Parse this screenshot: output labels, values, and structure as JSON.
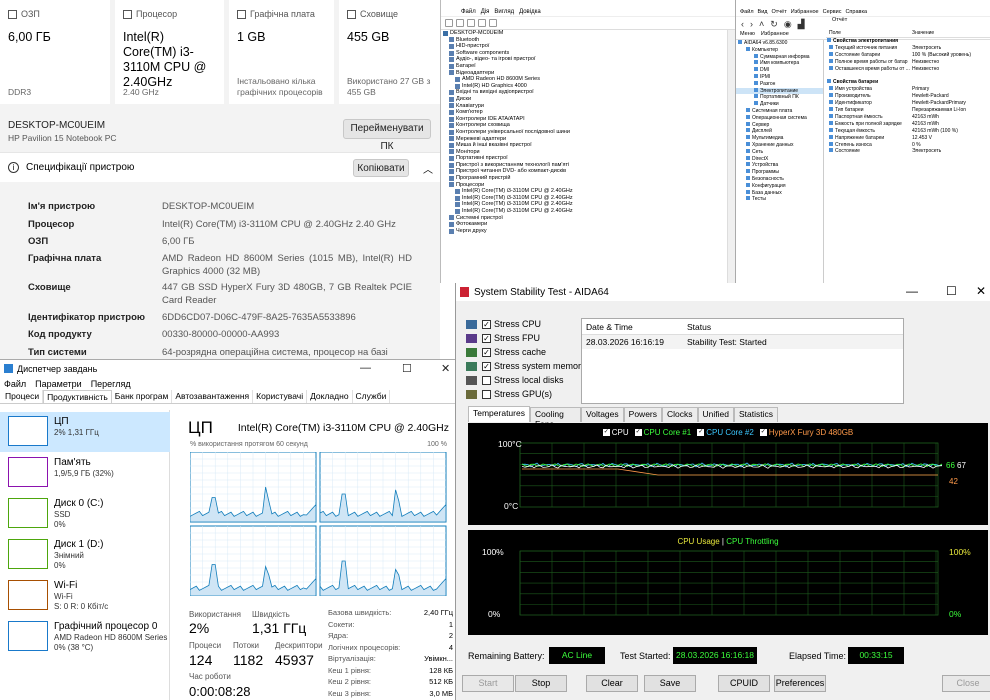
{
  "settings": {
    "cards": [
      {
        "icon": "memory-icon",
        "label": "ОЗП",
        "value": "6,00 ГБ",
        "sub": "DDR3"
      },
      {
        "icon": "processor-icon",
        "label": "Процесор",
        "value": "Intel(R) Core(TM) i3-3110M CPU @ 2.40GHz",
        "sub": "2.40 GHz"
      },
      {
        "icon": "gpu-icon",
        "label": "Графічна плата",
        "value": "1 GB",
        "sub": "Інстальовано кілька графічних процесорів"
      },
      {
        "icon": "storage-icon",
        "label": "Сховище",
        "value": "455 GB",
        "sub": "Використано 27 GB з 455 GB"
      }
    ],
    "device_name": "DESKTOP-MC0UEIM",
    "device_model": "HP Pavilion 15 Notebook PC",
    "rename_button": "Перейменувати ПК",
    "spec_header": "Специфікації пристрою",
    "copy_button": "Копіювати",
    "specs": [
      {
        "k": "Ім'я пристрою",
        "v": "DESKTOP-MC0UEIM"
      },
      {
        "k": "Процесор",
        "v": "Intel(R) Core(TM) i3-3110M CPU @ 2.40GHz   2.40 GHz"
      },
      {
        "k": "ОЗП",
        "v": "6,00 ГБ"
      },
      {
        "k": "Графічна плата",
        "v": "AMD Radeon HD 8600M Series (1015 MB), Intel(R) HD Graphics 4000 (32 MB)"
      },
      {
        "k": "Сховище",
        "v": "447 GB SSD HyperX Fury 3D 480GB, 7 GB Realtek PCIE Card Reader"
      },
      {
        "k": "Ідентифікатор пристрою",
        "v": "6DD6CD07-D06C-479F-8A25-7635A5533896"
      },
      {
        "k": "Код продукту",
        "v": "00330-80000-00000-AA993"
      },
      {
        "k": "Тип системи",
        "v": "64-розрядна операційна система, процесор на базі"
      }
    ]
  },
  "devmgr": {
    "menu": [
      "Файл",
      "Дія",
      "Вигляд",
      "Довідка"
    ],
    "tree": [
      {
        "t": "DESKTOP-MC0UEIM",
        "d": 0
      },
      {
        "t": "Bluetooth",
        "d": 1
      },
      {
        "t": "HID-пристрої",
        "d": 1
      },
      {
        "t": "Software components",
        "d": 1
      },
      {
        "t": "Аудіо-, відео- та ігрові пристрої",
        "d": 1
      },
      {
        "t": "Батареї",
        "d": 1
      },
      {
        "t": "Відеоадаптери",
        "d": 1
      },
      {
        "t": "AMD Radeon HD 8600M Series",
        "d": 2
      },
      {
        "t": "Intel(R) HD Graphics 4000",
        "d": 2
      },
      {
        "t": "Вхідні та вихідні аудіопристрої",
        "d": 1
      },
      {
        "t": "Диски",
        "d": 1
      },
      {
        "t": "Клавіатури",
        "d": 1
      },
      {
        "t": "Комп'ютер",
        "d": 1
      },
      {
        "t": "Контролери IDE ATA/ATAPI",
        "d": 1
      },
      {
        "t": "Контролери сховища",
        "d": 1
      },
      {
        "t": "Контролери універсальної послідовної шини",
        "d": 1
      },
      {
        "t": "Мережеві адаптери",
        "d": 1
      },
      {
        "t": "Миша й інші вказівні пристрої",
        "d": 1
      },
      {
        "t": "Монітори",
        "d": 1
      },
      {
        "t": "Портативні пристрої",
        "d": 1
      },
      {
        "t": "Пристрої з використанням технології пам'яті",
        "d": 1
      },
      {
        "t": "Пристрої читання DVD- або компакт-дисків",
        "d": 1
      },
      {
        "t": "Програмний пристрій",
        "d": 1
      },
      {
        "t": "Процесори",
        "d": 1
      },
      {
        "t": "Intel(R) Core(TM) i3-3110M CPU @ 2.40GHz",
        "d": 2
      },
      {
        "t": "Intel(R) Core(TM) i3-3110M CPU @ 2.40GHz",
        "d": 2
      },
      {
        "t": "Intel(R) Core(TM) i3-3110M CPU @ 2.40GHz",
        "d": 2
      },
      {
        "t": "Intel(R) Core(TM) i3-3110M CPU @ 2.40GHz",
        "d": 2
      },
      {
        "t": "Системні пристрої",
        "d": 1
      },
      {
        "t": "Фотокамери",
        "d": 1
      },
      {
        "t": "Черги друку",
        "d": 1
      }
    ]
  },
  "aida": {
    "menu": [
      "Файл",
      "Вид",
      "Отчёт",
      "Избранное",
      "Сервис",
      "Справка"
    ],
    "nav_report": "Отчёт",
    "tabs": [
      "Меню",
      "Избранное"
    ],
    "col_field": "Поле",
    "col_value": "Значение",
    "tree": [
      {
        "t": "AIDA64 v6.85.6300",
        "d": 0
      },
      {
        "t": "Компьютер",
        "d": 1
      },
      {
        "t": "Суммарная информа",
        "d": 2
      },
      {
        "t": "Имя компьютера",
        "d": 2
      },
      {
        "t": "DMI",
        "d": 2
      },
      {
        "t": "IPMI",
        "d": 2
      },
      {
        "t": "Разгон",
        "d": 2
      },
      {
        "t": "Электропитание",
        "d": 2,
        "sel": true
      },
      {
        "t": "Портативный ПК",
        "d": 2
      },
      {
        "t": "Датчики",
        "d": 2
      },
      {
        "t": "Системная плата",
        "d": 1
      },
      {
        "t": "Операционная система",
        "d": 1
      },
      {
        "t": "Сервер",
        "d": 1
      },
      {
        "t": "Дисплей",
        "d": 1
      },
      {
        "t": "Мультимедиа",
        "d": 1
      },
      {
        "t": "Хранение данных",
        "d": 1
      },
      {
        "t": "Сеть",
        "d": 1
      },
      {
        "t": "DirectX",
        "d": 1
      },
      {
        "t": "Устройства",
        "d": 1
      },
      {
        "t": "Программы",
        "d": 1
      },
      {
        "t": "Безопасность",
        "d": 1
      },
      {
        "t": "Конфигурация",
        "d": 1
      },
      {
        "t": "База данных",
        "d": 1
      },
      {
        "t": "Тесты",
        "d": 1
      }
    ],
    "rows": [
      {
        "f": "Свойства электропитания",
        "v": "",
        "h": true
      },
      {
        "f": "Текущий источник питания",
        "v": "Электросеть"
      },
      {
        "f": "Состояние батареи",
        "v": "100 % (Высокий уровень)"
      },
      {
        "f": "Полное время работы от батар",
        "v": "Неизвестно"
      },
      {
        "f": "Оставшееся время работы от ...",
        "v": "Неизвестно"
      },
      {
        "f": "",
        "v": ""
      },
      {
        "f": "Свойства батареи",
        "v": "",
        "h": true
      },
      {
        "f": "Имя устройства",
        "v": "Primary"
      },
      {
        "f": "Производитель",
        "v": "Hewlett-Packard"
      },
      {
        "f": "Идентификатор",
        "v": "Hewlett-PackardPrimary"
      },
      {
        "f": "Тип батареи",
        "v": "Перезаряжаемая Li-Ion"
      },
      {
        "f": "Паспортная ёмкость",
        "v": "42163 mWh"
      },
      {
        "f": "Ёмкость при полной зарядке",
        "v": "42163 mWh"
      },
      {
        "f": "Текущая ёмкость",
        "v": "42163 mWh  (100 %)"
      },
      {
        "f": "Напряжение батареи",
        "v": "12.453 V"
      },
      {
        "f": "Степень износа",
        "v": "0 %"
      },
      {
        "f": "Состояние",
        "v": "Электросеть"
      }
    ]
  },
  "taskmgr": {
    "title": "Диспетчер завдань",
    "menu": [
      "Файл",
      "Параметри",
      "Перегляд"
    ],
    "tabs": [
      "Процеси",
      "Продуктивність",
      "Банк програм",
      "Автозавантаження",
      "Користувачі",
      "Докладно",
      "Служби"
    ],
    "side": [
      {
        "name": "ЦП",
        "s1": "2% 1,31 ГГц",
        "s2": "",
        "color": "#1979ca"
      },
      {
        "name": "Пам'ять",
        "s1": "1,9/5,9 ГБ (32%)",
        "s2": "",
        "color": "#8b12ae"
      },
      {
        "name": "Диск 0 (C:)",
        "s1": "SSD",
        "s2": "0%",
        "color": "#4da60c"
      },
      {
        "name": "Диск 1 (D:)",
        "s1": "Знімний",
        "s2": "0%",
        "color": "#4da60c"
      },
      {
        "name": "Wi-Fi",
        "s1": "Wi-Fi",
        "s2": "S: 0 R: 0 Кбіт/с",
        "color": "#a74f01"
      },
      {
        "name": "Графічний процесор 0",
        "s1": "AMD Radeon HD 8600M Series",
        "s2": "0% (38 °C)",
        "color": "#1979ca"
      }
    ],
    "main_title": "ЦП",
    "cpu_name": "Intel(R) Core(TM) i3-3110M CPU @ 2.40GHz",
    "graph_caption": "% використання протягом 60 секунд",
    "graph_max": "100 %",
    "stats": {
      "usage_l": "Використання",
      "usage_v": "2%",
      "speed_l": "Швидкість",
      "speed_v": "1,31 ГГц",
      "proc_l": "Процеси",
      "proc_v": "124",
      "threads_l": "Потоки",
      "threads_v": "1182",
      "handles_l": "Дескриптори",
      "handles_v": "45937",
      "uptime_l": "Час роботи",
      "uptime_v": "0:00:08:28"
    },
    "specs": [
      {
        "k": "Базова швидкість:",
        "v": "2,40 ГГц"
      },
      {
        "k": "Сокети:",
        "v": "1"
      },
      {
        "k": "Ядра:",
        "v": "2"
      },
      {
        "k": "Логічних процесорів:",
        "v": "4"
      },
      {
        "k": "Віртуалізація:",
        "v": "Увімкн..."
      },
      {
        "k": "Кеш 1 рівня:",
        "v": "128 КБ"
      },
      {
        "k": "Кеш 2 рівня:",
        "v": "512 КБ"
      },
      {
        "k": "Кеш 3 рівня:",
        "v": "3,0 МБ"
      }
    ]
  },
  "stability": {
    "title": "System Stability Test - AIDA64",
    "checks": [
      {
        "label": "Stress CPU",
        "checked": true
      },
      {
        "label": "Stress FPU",
        "checked": true
      },
      {
        "label": "Stress cache",
        "checked": true
      },
      {
        "label": "Stress system memory",
        "checked": true
      },
      {
        "label": "Stress local disks",
        "checked": false
      },
      {
        "label": "Stress GPU(s)",
        "checked": false
      }
    ],
    "log_head_date": "Date & Time",
    "log_head_status": "Status",
    "log_date": "28.03.2026 16:16:19",
    "log_status": "Stability Test: Started",
    "tabs": [
      "Temperatures",
      "Cooling Fans",
      "Voltages",
      "Powers",
      "Clocks",
      "Unified",
      "Statistics"
    ],
    "legend": [
      {
        "label": "CPU",
        "color": "#ffffff"
      },
      {
        "label": "CPU Core #1",
        "color": "#3cff3c"
      },
      {
        "label": "CPU Core #2",
        "color": "#3cc8ff"
      },
      {
        "label": "HyperX Fury 3D 480GB",
        "color": "#ff9a4a"
      }
    ],
    "t_top": "100°C",
    "t_bot": "0°C",
    "t_r1": "66",
    "t_r2": "67",
    "t_r3": "42",
    "usage_legend_a": "CPU Usage",
    "usage_legend_sep": "|",
    "usage_legend_b": "CPU Throttling",
    "u_top": "100%",
    "u_bot": "0%",
    "u_rtop": "100%",
    "u_rbot": "0%",
    "battery_l": "Remaining Battery:",
    "battery_v": "AC Line",
    "started_l": "Test Started:",
    "started_v": "28.03.2026 16:16:18",
    "elapsed_l": "Elapsed Time:",
    "elapsed_v": "00:33:15",
    "buttons": [
      "Start",
      "Stop",
      "Clear",
      "Save",
      "CPUID",
      "Preferences",
      "Close"
    ]
  }
}
